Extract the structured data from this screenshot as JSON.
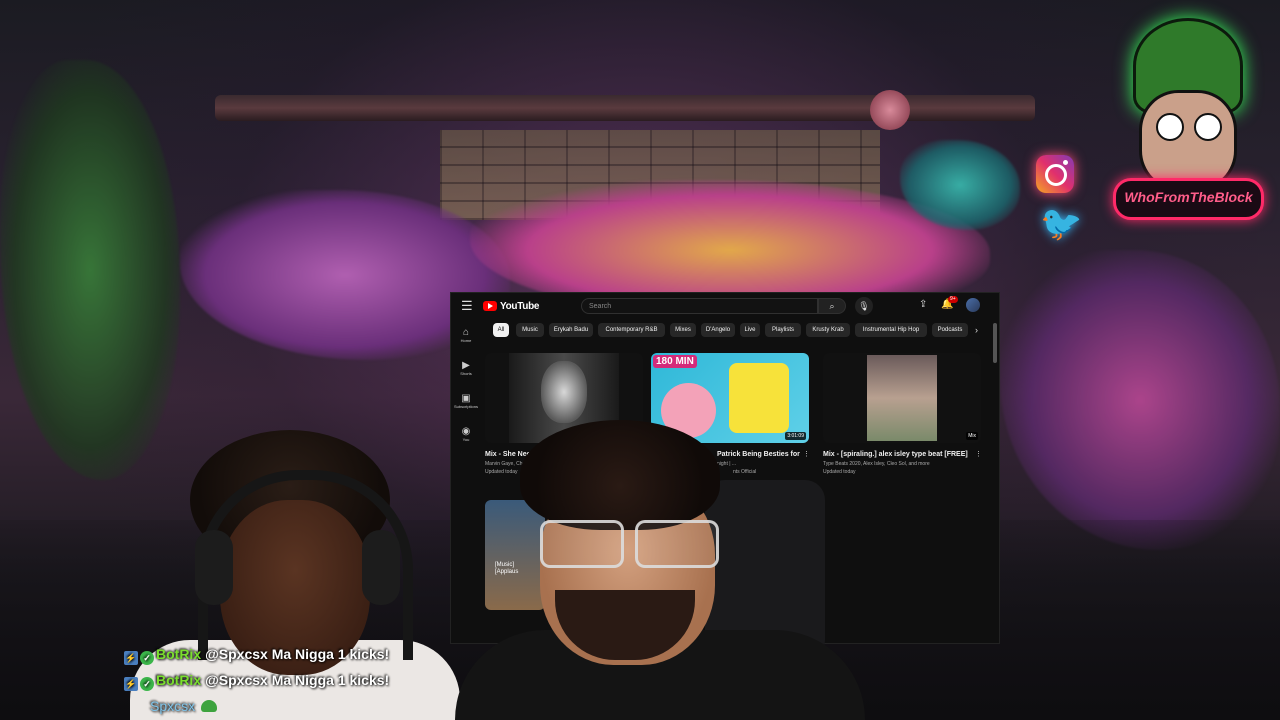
{
  "overlay": {
    "logo_text": "WhoFromTheBlock",
    "social": [
      "instagram-icon",
      "twitter-icon"
    ]
  },
  "youtube": {
    "logo": "YouTube",
    "search_placeholder": "Search",
    "notification_count": "9+",
    "sidebar": [
      {
        "icon": "home-icon",
        "label": "Home"
      },
      {
        "icon": "shorts-icon",
        "label": "Shorts"
      },
      {
        "icon": "subscriptions-icon",
        "label": "Subscriptions"
      },
      {
        "icon": "you-icon",
        "label": "You"
      }
    ],
    "chips": [
      "All",
      "Music",
      "Erykah Badu",
      "Contemporary R&B",
      "Mixes",
      "D'Angelo",
      "Live",
      "Playlists",
      "Krusty Krab",
      "Instrumental Hip Hop",
      "Podcasts"
    ],
    "videos": [
      {
        "title": "Mix - She Needs",
        "meta": "Marvin Gaye, Ch",
        "meta2": "Updated today",
        "duration": ""
      },
      {
        "title": "Patrick Being Besties for",
        "meta": "night | ...",
        "meta2": "nts Official",
        "duration": "3:01:09",
        "thumb_text": "180 MIN"
      },
      {
        "title": "Mix - [spiraling.] alex isley type beat [FREE]",
        "meta": "Type Beats 2020, Alex Isley, Cleo Sol, and more",
        "meta2": "Updated today",
        "duration": "Mix"
      }
    ],
    "row2_thumb_text": "[Music] [Applaus"
  },
  "chat": {
    "messages": [
      {
        "user": "BotRix",
        "text": "@Spxcsx Ma Nigga 1 kicks!"
      },
      {
        "user": "BotRix",
        "text": "@Spxcsx Ma Nigga 1 kicks!"
      },
      {
        "user": "Spxcsx",
        "text": ""
      }
    ]
  }
}
